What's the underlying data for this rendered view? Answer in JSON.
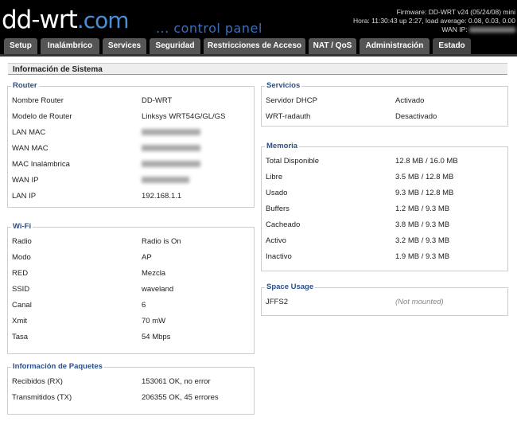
{
  "header": {
    "logo_main": "dd-wrt",
    "logo_suffix": ".com",
    "panel_title": "... control panel",
    "firmware": "Firmware: DD-WRT v24 (05/24/08) mini",
    "time_info": "Hora: 11:30:43 up 2:27, load average: 0.08, 0.03, 0.00",
    "wan_ip_label": "WAN IP:"
  },
  "tabs": [
    "Setup",
    "Inalámbrico",
    "Services",
    "Seguridad",
    "Restricciones de Acceso",
    "NAT / QoS",
    "Administración",
    "Estado"
  ],
  "page_title": "Información de Sistema",
  "router": {
    "legend": "Router",
    "rows": [
      {
        "label": "Nombre Router",
        "value": "DD-WRT"
      },
      {
        "label": "Modelo de Router",
        "value": "Linksys WRT54G/GL/GS"
      },
      {
        "label": "LAN MAC",
        "value": ""
      },
      {
        "label": "WAN MAC",
        "value": ""
      },
      {
        "label": "MAC Inalámbrica",
        "value": ""
      },
      {
        "label": "WAN IP",
        "value": ""
      },
      {
        "label": "LAN IP",
        "value": "192.168.1.1"
      }
    ]
  },
  "wifi": {
    "legend": "Wi-Fi",
    "rows": [
      {
        "label": "Radio",
        "value": "Radio is On"
      },
      {
        "label": "Modo",
        "value": "AP"
      },
      {
        "label": "RED",
        "value": "Mezcla"
      },
      {
        "label": "SSID",
        "value": "waveland"
      },
      {
        "label": "Canal",
        "value": "6"
      },
      {
        "label": "Xmit",
        "value": "70 mW"
      },
      {
        "label": "Tasa",
        "value": "54 Mbps"
      }
    ]
  },
  "packets": {
    "legend": "Información de Paquetes",
    "rows": [
      {
        "label": "Recibidos (RX)",
        "value": "153061 OK, no error"
      },
      {
        "label": "Transmitidos (TX)",
        "value": "206355 OK, 45 errores"
      }
    ]
  },
  "services": {
    "legend": "Servicios",
    "rows": [
      {
        "label": "Servidor DHCP",
        "value": "Activado"
      },
      {
        "label": "WRT-radauth",
        "value": "Desactivado"
      }
    ]
  },
  "memory": {
    "legend": "Memoria",
    "rows": [
      {
        "label": "Total Disponible",
        "value": "12.8 MB / 16.0 MB"
      },
      {
        "label": "Libre",
        "value": "3.5 MB / 12.8 MB"
      },
      {
        "label": "Usado",
        "value": "9.3 MB / 12.8 MB"
      },
      {
        "label": "Buffers",
        "value": "1.2 MB / 9.3 MB"
      },
      {
        "label": "Cacheado",
        "value": "3.8 MB / 9.3 MB"
      },
      {
        "label": "Activo",
        "value": "3.2 MB / 9.3 MB"
      },
      {
        "label": "Inactivo",
        "value": "1.9 MB / 9.3 MB"
      }
    ]
  },
  "space": {
    "legend": "Space Usage",
    "rows": [
      {
        "label": "JFFS2",
        "value": "(Not mounted)"
      }
    ]
  }
}
